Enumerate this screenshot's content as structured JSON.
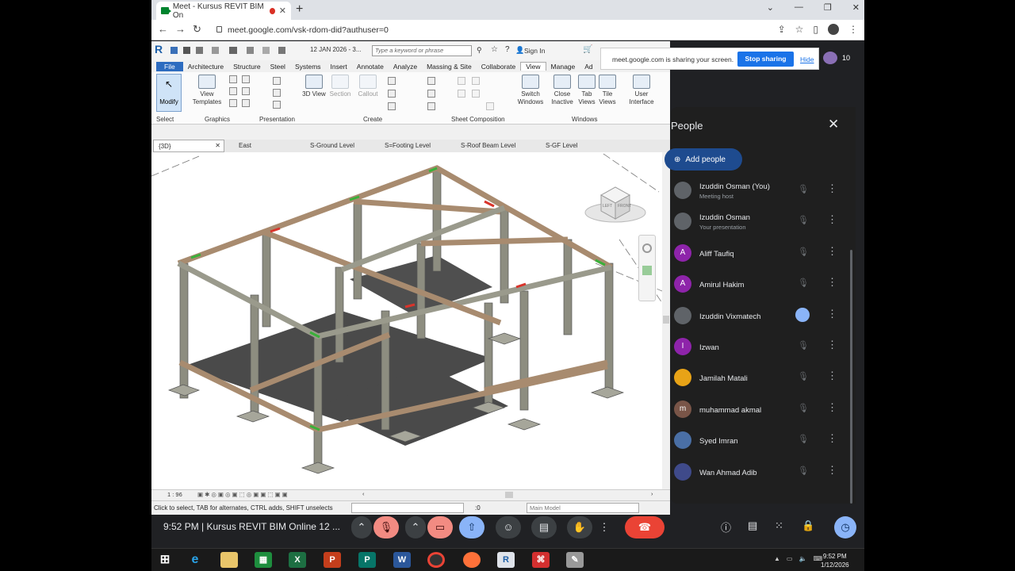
{
  "browser": {
    "tab_title": "Meet - Kursus REVIT BIM On",
    "url": "meet.google.com/vsk-rdom-did?authuser=0"
  },
  "revit": {
    "date_text": "12 JAN 2026 - 3...",
    "keyword_placeholder": "Type a keyword or phrase",
    "sign_in": "Sign In",
    "menu": [
      "File",
      "Architecture",
      "Structure",
      "Steel",
      "Systems",
      "Insert",
      "Annotate",
      "Analyze",
      "Massing & Site",
      "Collaborate",
      "View",
      "Manage",
      "Ad"
    ],
    "active_menu": "View",
    "ribbon": {
      "modify": "Modify",
      "view_templates": "View Templates",
      "view_3d": "3D View",
      "section": "Section",
      "callout": "Callout",
      "switch_windows": "Switch Windows",
      "close_inactive": "Close Inactive",
      "tab_views": "Tab Views",
      "tile_views": "Tile Views",
      "user_interface": "User Interface",
      "groups": [
        "Select",
        "Graphics",
        "Presentation",
        "Create",
        "Sheet Composition",
        "Windows"
      ]
    },
    "view_tabs": [
      "{3D}",
      "East",
      "S-Ground Level",
      "S=Footing Level",
      "S-Roof Beam Level",
      "S-GF Level"
    ],
    "scale": "1 : 96",
    "status": "Click to select, TAB for alternates, CTRL adds, SHIFT unselects",
    "filter_count": ":0",
    "model": "Main Model",
    "viewcube_top": "LEFT",
    "viewcube_front": "FRONT"
  },
  "share_banner": {
    "text": "meet.google.com is sharing your screen.",
    "stop": "Stop sharing",
    "hide": "Hide"
  },
  "participant_count": "10",
  "people": {
    "title": "People",
    "add": "Add people",
    "list": [
      {
        "name": "Izuddin Osman (You)",
        "sub": "Meeting host",
        "initial": "",
        "color": "#5f6368"
      },
      {
        "name": "Izuddin Osman",
        "sub": "Your presentation",
        "initial": "",
        "color": "#5f6368"
      },
      {
        "name": "Aliff Taufiq",
        "sub": "",
        "initial": "A",
        "color": "#8e24aa"
      },
      {
        "name": "Amirul Hakim",
        "sub": "",
        "initial": "A",
        "color": "#8e24aa"
      },
      {
        "name": "Izuddin Vixmatech",
        "sub": "",
        "initial": "",
        "color": "#5f6368"
      },
      {
        "name": "Izwan",
        "sub": "",
        "initial": "I",
        "color": "#8e24aa"
      },
      {
        "name": "Jamilah Matali",
        "sub": "",
        "initial": "",
        "color": "#e8a317"
      },
      {
        "name": "muhammad akmal",
        "sub": "",
        "initial": "m",
        "color": "#795548"
      },
      {
        "name": "Syed Imran",
        "sub": "",
        "initial": "",
        "color": "#4a6fa5"
      },
      {
        "name": "Wan Ahmad Adib",
        "sub": "",
        "initial": "",
        "color": "#3f4a8a"
      }
    ]
  },
  "meet": {
    "time_title": "9:52 PM  |  Kursus REVIT BIM Online 12 ..."
  },
  "taskbar": {
    "time": "9:52 PM",
    "date": "1/12/2026"
  }
}
